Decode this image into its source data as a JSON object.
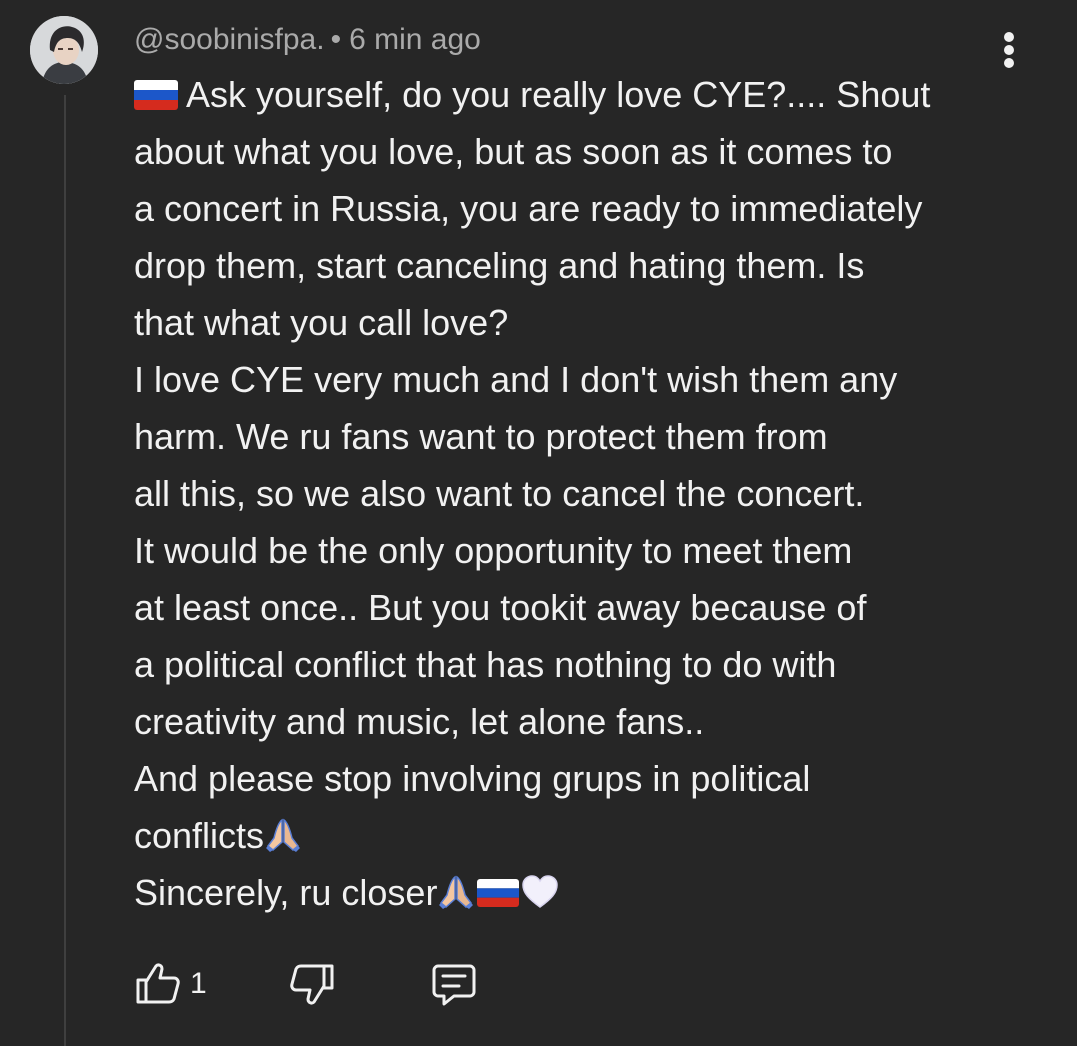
{
  "comment": {
    "username": "@soobinisfpa.",
    "separator": "•",
    "timestamp": "6 min ago",
    "lines": [
      "Ask yourself, do you really love CYE?.... Shout",
      "about what you love, but as soon as it comes to",
      "a concert in Russia, you are ready to immediately",
      "drop them, start canceling and hating them. Is",
      "that what you call love?",
      "I love CYE very much and I don't wish them any",
      "harm. We ru fans want to protect them from",
      "all this, so we also want to cancel the concert.",
      "It would be the only opportunity to meet them",
      "at least once.. But you tookit away because of",
      "a political conflict that has nothing to do with",
      "creativity and music, let alone fans..",
      "And please stop involving grups in political",
      "conflicts",
      "Sincerely, ru closer"
    ],
    "like_count": "1"
  },
  "icons": {
    "avatar": "user-avatar",
    "more": "more-vertical-icon",
    "like": "thumb-up-icon",
    "dislike": "thumb-down-icon",
    "reply": "comment-icon",
    "flag": "russia-flag-emoji",
    "pray": "folded-hands-emoji",
    "heart": "white-heart-emoji"
  },
  "colors": {
    "background": "#262626",
    "text": "#f1f1f1",
    "meta_text": "#aaaaaa",
    "thread_line": "#3f3f3f"
  }
}
